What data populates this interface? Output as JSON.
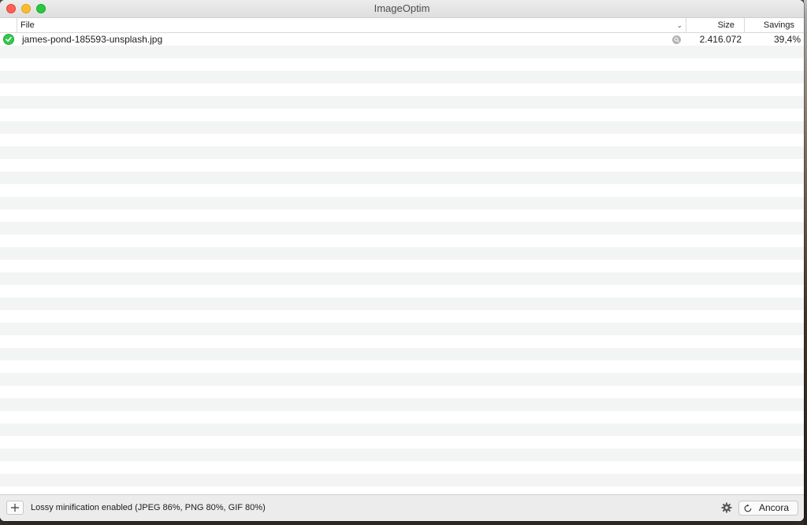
{
  "window": {
    "title": "ImageOptim"
  },
  "columns": {
    "file": "File",
    "size": "Size",
    "savings": "Savings"
  },
  "files": [
    {
      "status": "check-icon",
      "name": "james-pond-185593-unsplash.jpg",
      "size": "2.416.072",
      "savings": "39,4%"
    }
  ],
  "footer": {
    "status_text": "Lossy minification enabled (JPEG 86%, PNG 80%, GIF 80%)",
    "again_label": "Ancora"
  },
  "icons": {
    "add": "plus-icon",
    "settings": "gear-icon",
    "again": "refresh-icon",
    "quicklook": "magnifier-icon",
    "sort": "chevron-down-icon"
  },
  "colors": {
    "success": "#33c94a",
    "close": "#fe5f57",
    "minimize": "#febc2e",
    "maximize": "#28c840"
  }
}
